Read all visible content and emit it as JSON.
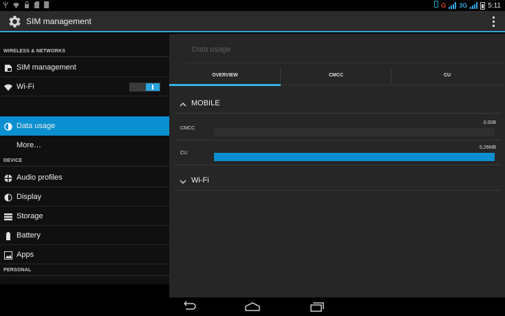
{
  "status_bar": {
    "network": "3G",
    "carrier_indicator": "G",
    "clock": "5:11",
    "icons": [
      "usb-icon",
      "wifi-icon",
      "lock-icon",
      "sd-card-icon",
      "file-icon"
    ]
  },
  "action_bar": {
    "title": "SIM management",
    "icon": "gear-icon"
  },
  "sidebar": {
    "sections": {
      "wireless": "WIRELESS & NETWORKS",
      "device": "DEVICE",
      "personal": "PERSONAL"
    },
    "items": [
      {
        "label": "SIM management",
        "icon": "sim-icon"
      },
      {
        "label": "Wi-Fi",
        "icon": "wifi-icon",
        "toggle": "on"
      },
      {
        "label": "Data usage",
        "icon": "data-usage-icon",
        "selected": true
      },
      {
        "label": "More…",
        "icon": ""
      },
      {
        "label": "Audio profiles",
        "icon": "audio-icon"
      },
      {
        "label": "Display",
        "icon": "display-icon"
      },
      {
        "label": "Storage",
        "icon": "storage-icon"
      },
      {
        "label": "Battery",
        "icon": "battery-icon"
      },
      {
        "label": "Apps",
        "icon": "apps-icon"
      }
    ]
  },
  "main": {
    "title": "Data usage",
    "tabs": [
      "OVERVIEW",
      "CMCC",
      "CU"
    ],
    "active_tab": 0,
    "mobile_group": "MOBILE",
    "wifi_group": "Wi-Fi",
    "usage": [
      {
        "name": "CMCC",
        "amount": "0.00B",
        "fraction": 0.0
      },
      {
        "name": "CU",
        "amount": "5.26MB",
        "fraction": 1.0
      }
    ]
  },
  "colors": {
    "accent": "#33b5e5",
    "selected": "#0a90d0",
    "background": "#262626"
  }
}
